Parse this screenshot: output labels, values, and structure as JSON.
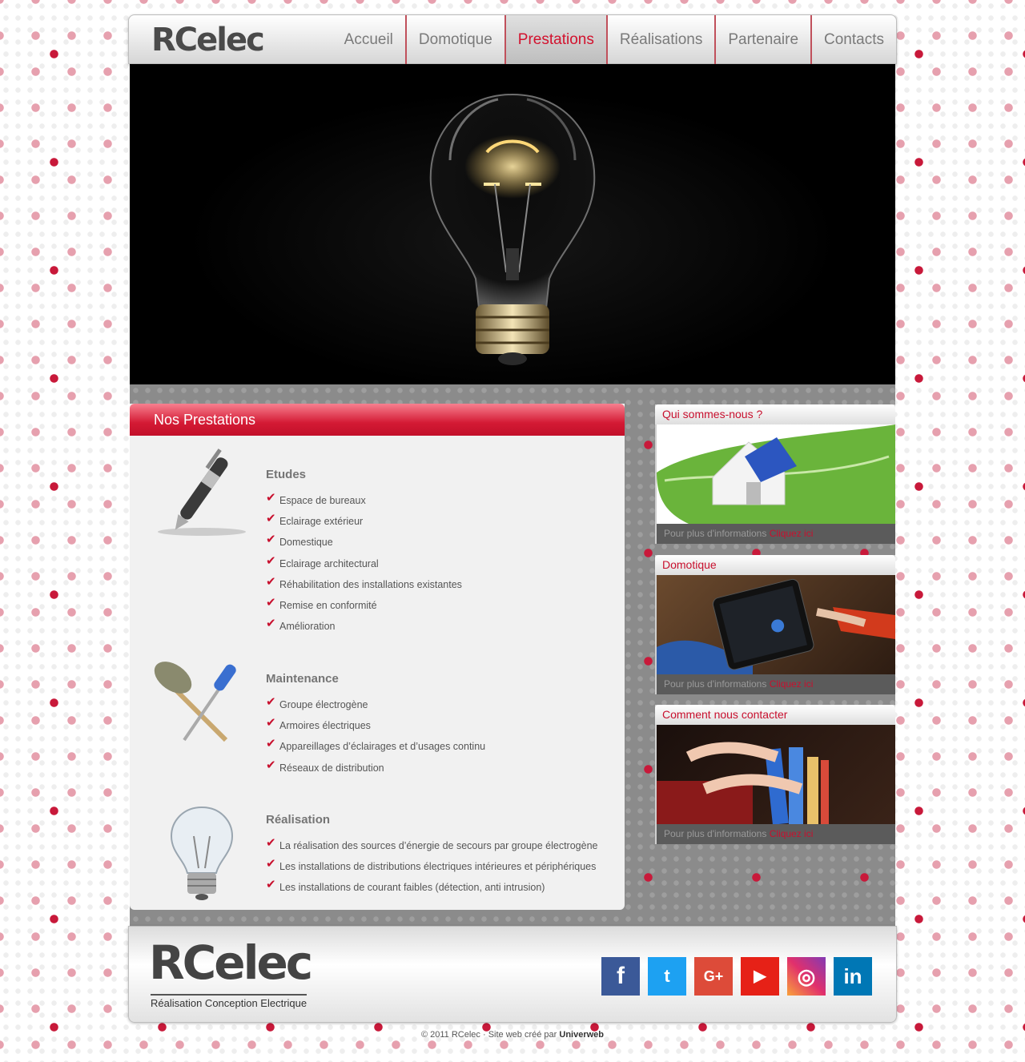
{
  "brand": {
    "logo": "RCelec"
  },
  "nav": {
    "items": [
      {
        "label": "Accueil"
      },
      {
        "label": "Domotique"
      },
      {
        "label": "Prestations"
      },
      {
        "label": "Réalisations"
      },
      {
        "label": "Partenaire"
      },
      {
        "label": "Contacts"
      }
    ],
    "active": "Prestations"
  },
  "main": {
    "title": "Nos Prestations",
    "sections": [
      {
        "title": "Etudes",
        "icon": "pen-icon",
        "items": [
          "Espace de bureaux",
          "Eclairage extérieur",
          "Domestique",
          "Eclairage architectural",
          "Réhabilitation des installations existantes",
          "Remise en conformité",
          "Amélioration"
        ]
      },
      {
        "title": "Maintenance",
        "icon": "tools-icon",
        "items": [
          "Groupe électrogène",
          "Armoires électriques",
          "Appareillages d’éclairages et d’usages continu",
          "Réseaux de distribution"
        ]
      },
      {
        "title": "Réalisation",
        "icon": "lightbulb-icon",
        "items": [
          "La réalisation des sources d’énergie de secours par groupe électrogène",
          "Les installations de distributions électriques intérieures et périphériques",
          "Les installations de courant faibles (détection, anti intrusion)"
        ]
      }
    ]
  },
  "sidebar": {
    "boxes": [
      {
        "title": "Qui sommes-nous ?",
        "info": "Pour plus d'informations",
        "cta": "Cliquez ici"
      },
      {
        "title": "Domotique",
        "info": "Pour plus d'informations",
        "cta": "Cliquez ici"
      },
      {
        "title": "Comment nous contacter",
        "info": "Pour plus d'informations",
        "cta": "Cliquez ici"
      }
    ]
  },
  "footer": {
    "logo": "RCelec",
    "tagline": "Réalisation Conception Electrique",
    "social": [
      {
        "icon": "facebook-icon",
        "glyph": "f",
        "color": "#3b5998"
      },
      {
        "icon": "twitter-icon",
        "glyph": "t",
        "color": "#1da1f2"
      },
      {
        "icon": "google-plus-icon",
        "glyph": "G+",
        "color": "#dd4b39"
      },
      {
        "icon": "youtube-icon",
        "glyph": "▶",
        "color": "#e62117"
      },
      {
        "icon": "instagram-icon",
        "glyph": "◎",
        "color": "#c13584"
      },
      {
        "icon": "linkedin-icon",
        "glyph": "in",
        "color": "#0077b5"
      }
    ],
    "copyright": "© 2011 RCelec · Site web créé par",
    "credit": "Univerweb"
  },
  "colors": {
    "accent": "#d2122e",
    "nav_text": "#7a7a7a",
    "panel_bg": "#f1f1f1"
  }
}
